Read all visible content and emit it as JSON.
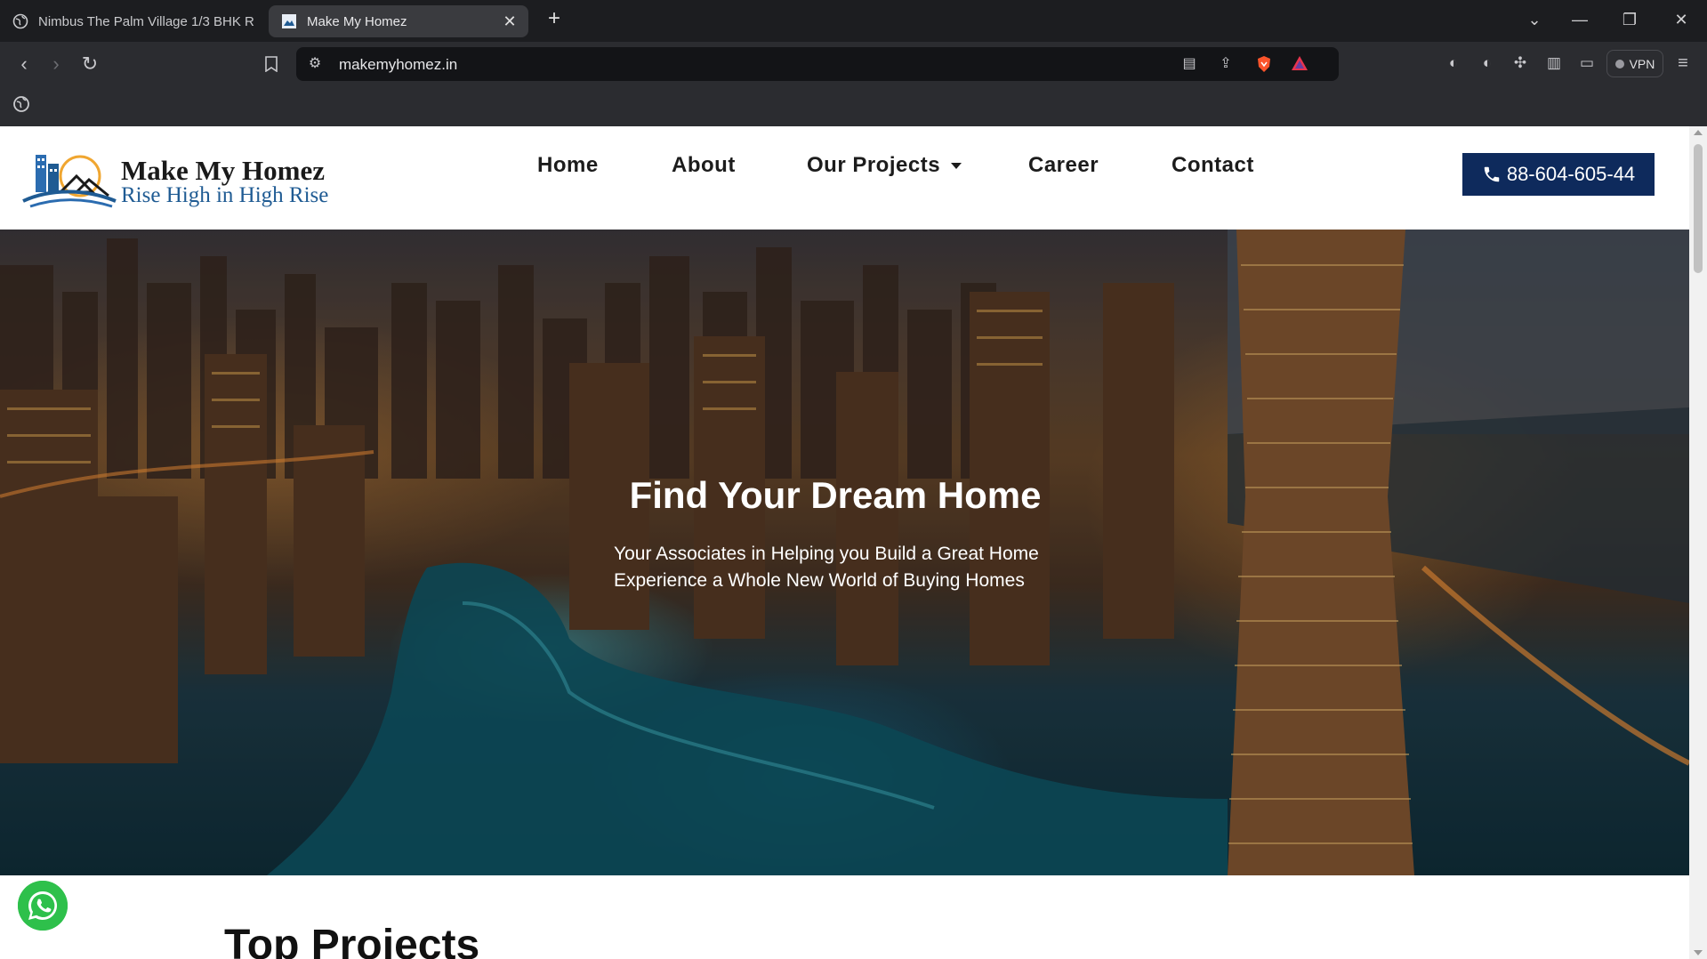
{
  "browser": {
    "tabs": [
      {
        "title": "Nimbus The Palm Village 1/3 BHK R",
        "active": false
      },
      {
        "title": "Make My Homez",
        "active": true
      }
    ],
    "url": "makemyhomez.in",
    "vpn_label": "VPN"
  },
  "site": {
    "logo": {
      "title": "Make My Homez",
      "tagline": "Rise High in High Rise"
    },
    "nav": [
      {
        "label": "Home"
      },
      {
        "label": "About"
      },
      {
        "label": "Our Projects"
      },
      {
        "label": "Career"
      },
      {
        "label": "Contact"
      }
    ],
    "phone": "88-604-605-44",
    "hero": {
      "title": "Find Your Dream Home",
      "line1": "Your Associates in Helping you Build a Great Home",
      "line2": "Experience a Whole New World of Buying Homes"
    },
    "section_title": "Top Projects"
  },
  "colors": {
    "brand_navy": "#0e2a5c",
    "logo_blue": "#1f5b93",
    "whatsapp_green": "#2ec04b"
  }
}
